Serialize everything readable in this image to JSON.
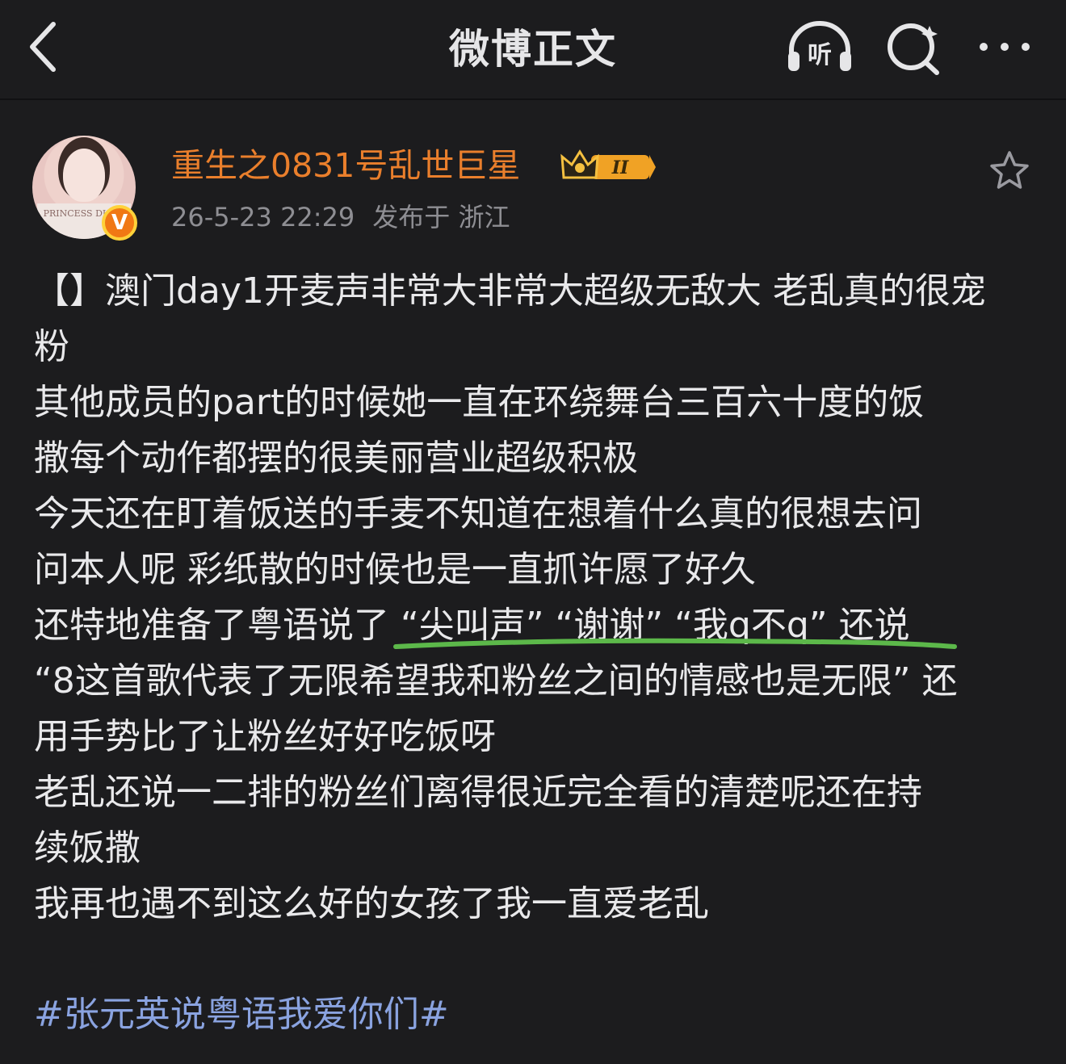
{
  "header": {
    "title": "微博正文",
    "listen_label": "听",
    "back_icon": "chevron-left-icon",
    "search_icon": "search-icon",
    "more_icon": "more-icon"
  },
  "author": {
    "name": "重生之0831号乱世巨星",
    "level": "II",
    "verified_mark": "V",
    "timestamp": "26-5-23 22:29",
    "location": "发布于 浙江",
    "avatar_text": "PRINCESS DIARY"
  },
  "post": {
    "lines": [
      "【】澳门day1开麦声非常大非常大超级无敌大 老乱真的很宠",
      "粉",
      "其他成员的part的时候她一直在环绕舞台三百六十度的饭",
      "撒每个动作都摆的很美丽营业超级积极",
      "今天还在盯着饭送的手麦不知道在想着什么真的很想去问",
      "问本人呢 彩纸散的时候也是一直抓许愿了好久",
      "还特地准备了粤语说了 “尖叫声” “谢谢” “我q不q” 还说",
      "“8这首歌代表了无限希望我和粉丝之间的情感也是无限” 还",
      "用手势比了让粉丝好好吃饭呀",
      "老乱还说一二排的粉丝们离得很近完全看的清楚呢还在持",
      "续饭撒",
      "我再也遇不到这么好的女孩了我一直爱老乱"
    ],
    "hashtag": "#张元英说粤语我爱你们#"
  },
  "colors": {
    "background": "#1c1c1e",
    "author_name": "#ea7f2c",
    "hashtag": "#8aa3e0",
    "underline": "#5cb84a",
    "meta": "#8e8e93"
  }
}
